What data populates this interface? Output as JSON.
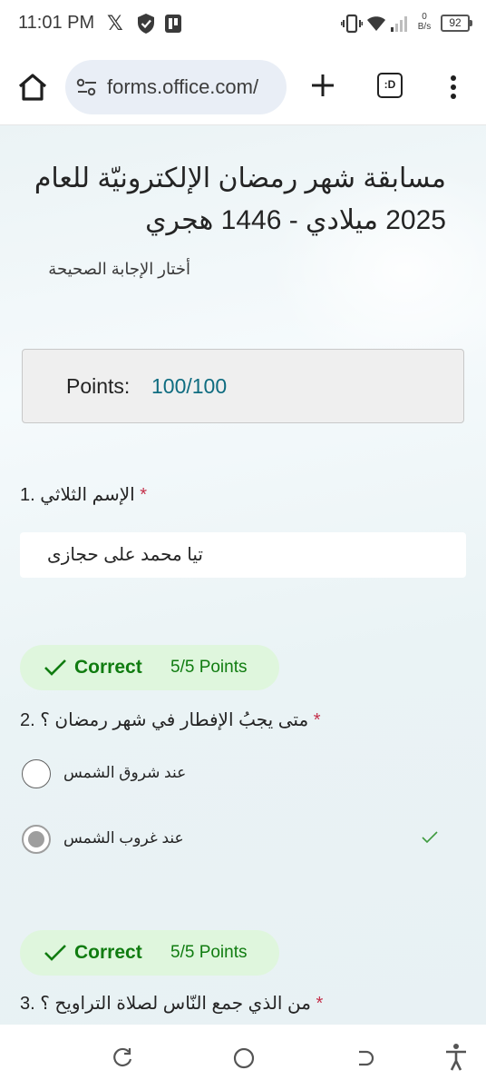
{
  "status_bar": {
    "time": "11:01 PM",
    "net_speed_value": "0",
    "net_speed_unit": "B/s",
    "battery": "92",
    "icons": [
      "x-icon",
      "shield-icon",
      "app-icon",
      "vibrate-icon",
      "wifi-icon",
      "signal-icon",
      "battery-icon"
    ]
  },
  "browser": {
    "url": "forms.office.com/",
    "tab_switcher_label": ":D",
    "icons": [
      "home-icon",
      "site-settings-icon",
      "plus-icon",
      "tab-switcher-icon",
      "more-menu-icon"
    ]
  },
  "form": {
    "title": "مسابقة شهر رمضان الإلكترونيّة للعام 2025 ميلادي - 1446 هجري",
    "description": "أختار الإجابة الصحيحة",
    "points_label": "Points:",
    "points_value": "100/100",
    "questions": [
      {
        "number": "1.",
        "title": "الإسم الثلاثي",
        "required_mark": "*",
        "answer": "تيا محمد على حجازى"
      },
      {
        "number": "2.",
        "title": "متى يجبُ الإفطار في شهر رمضان ؟",
        "required_mark": "*",
        "result_label": "Correct",
        "result_points": "5/5 Points",
        "options": [
          {
            "label": "عند شروق الشمس",
            "selected": false
          },
          {
            "label": "عند غروب الشمس",
            "selected": true,
            "correct": true
          }
        ]
      },
      {
        "number": "3.",
        "title": "من الذي جمع النّاس لصلاة التراويح ؟",
        "required_mark": "*",
        "result_label": "Correct",
        "result_points": "5/5 Points"
      }
    ]
  },
  "colors": {
    "accent_teal": "#0f6c80",
    "correct_green": "#107c10",
    "correct_bg": "#dff6dd",
    "required_red": "#c4314b"
  },
  "nav_bar": {
    "icons": [
      "recent-apps-icon",
      "home-circle-icon",
      "back-icon",
      "accessibility-icon"
    ]
  }
}
